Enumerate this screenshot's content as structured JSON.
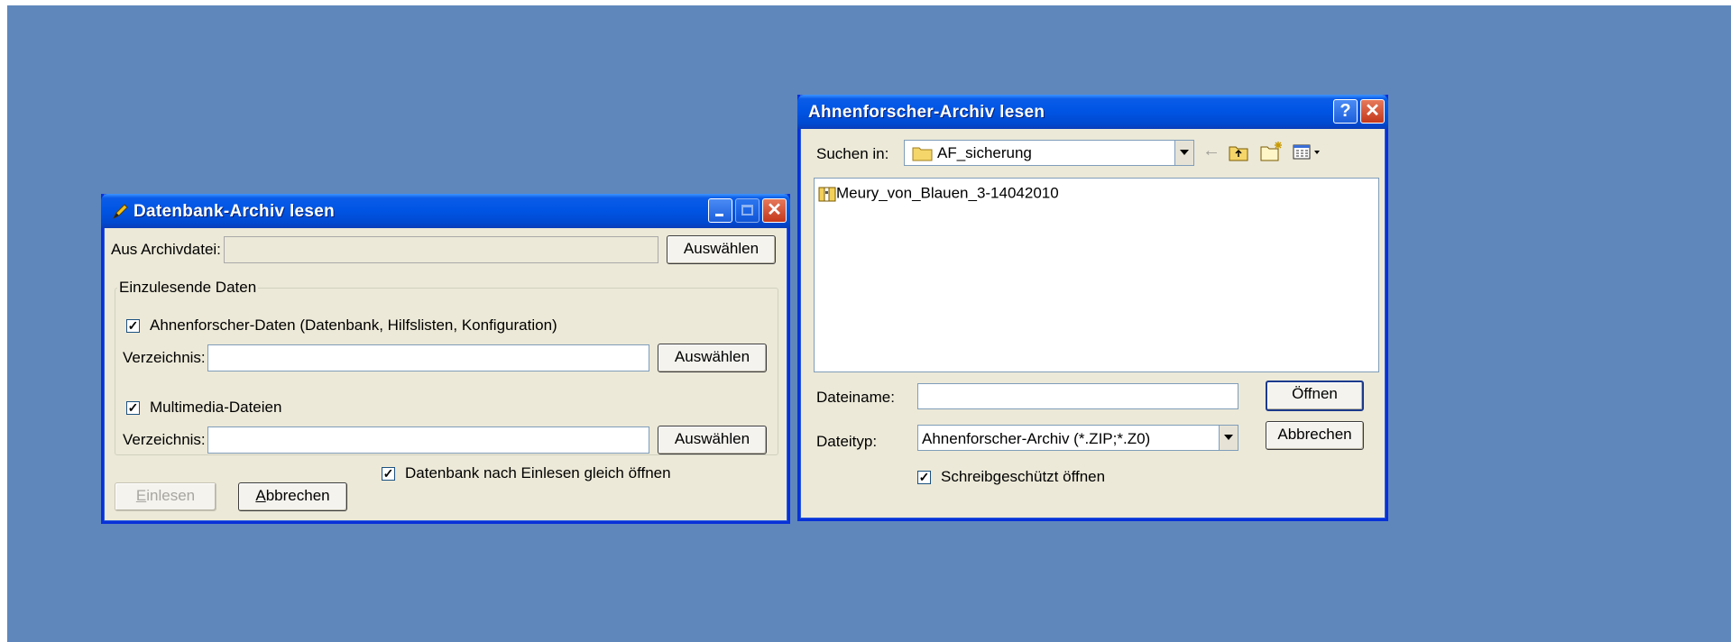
{
  "left_dialog": {
    "title": "Datenbank-Archiv lesen",
    "archive_label": "Aus Archivdatei:",
    "archive_value": "",
    "archive_select": "Auswählen",
    "group_title": "Einzulesende Daten",
    "af_data": {
      "checked": true,
      "label": "Ahnenforscher-Daten (Datenbank, Hilfslisten, Konfiguration)"
    },
    "dir1": {
      "label": "Verzeichnis:",
      "value": "",
      "button": "Auswählen"
    },
    "multimedia": {
      "checked": true,
      "label": "Multimedia-Dateien"
    },
    "dir2": {
      "label": "Verzeichnis:",
      "value": "",
      "button": "Auswählen"
    },
    "open_after": {
      "checked": true,
      "label": "Datenbank nach Einlesen gleich öffnen"
    },
    "read_button": {
      "first": "E",
      "rest": "inlesen"
    },
    "cancel_button": {
      "first": "A",
      "rest": "bbrechen"
    }
  },
  "right_dialog": {
    "title": "Ahnenforscher-Archiv lesen",
    "look_in_label": "Suchen in:",
    "look_in_value": "AF_sicherung",
    "files": [
      {
        "name": "Meury_von_Blauen_3-14042010",
        "icon": "archive-file-icon"
      }
    ],
    "filename_label": "Dateiname:",
    "filename_value": "",
    "open_button": "Öffnen",
    "filetype_label": "Dateityp:",
    "filetype_value": "Ahnenforscher-Archiv (*.ZIP;*.Z0)",
    "cancel_button": "Abbrechen",
    "readonly": {
      "checked": true,
      "label": "Schreibgeschützt öffnen"
    }
  },
  "checkmark": "✓"
}
